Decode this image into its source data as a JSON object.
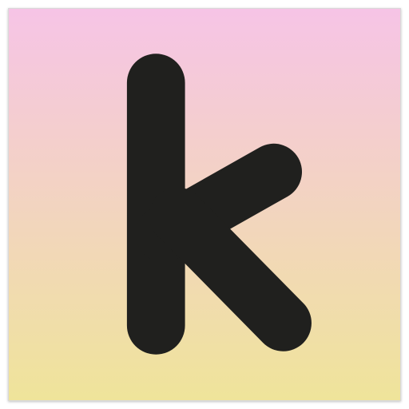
{
  "icon": {
    "name": "letter-k-app-icon",
    "glyph": "k",
    "colors": {
      "gradient_top": "#f6c4e6",
      "gradient_bottom": "#efe49a",
      "glyph": "#20201e",
      "border": "#d9d9d9"
    }
  }
}
